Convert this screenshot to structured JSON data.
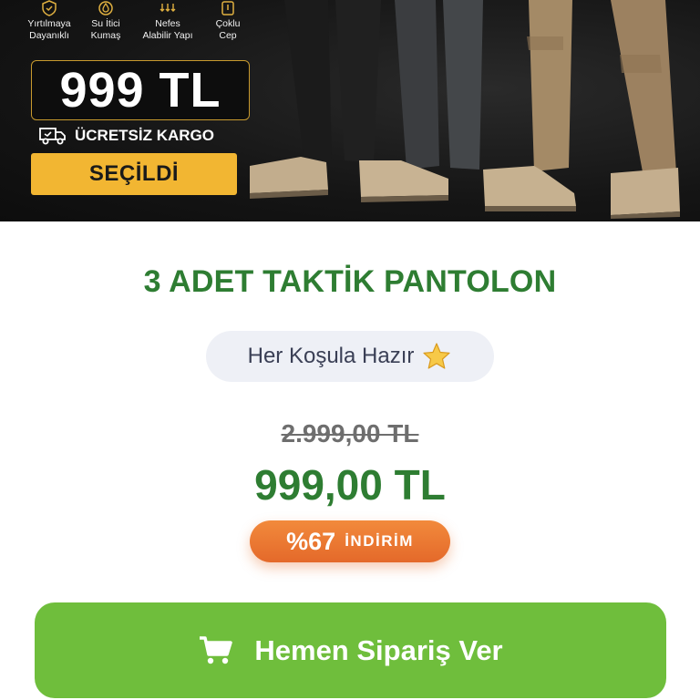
{
  "hero": {
    "features": [
      {
        "icon": "shield-icon",
        "label": "Yırtılmaya\nDayanıklı"
      },
      {
        "icon": "water-drop-icon",
        "label": "Su İtici\nKumaş"
      },
      {
        "icon": "arrows-down-icon",
        "label": "Nefes\nAlabilir Yapı"
      },
      {
        "icon": "pocket-icon",
        "label": "Çoklu\nCep"
      }
    ],
    "price": "999 TL",
    "cargo_label": "ÜCRETSİZ KARGO",
    "selected_label": "SEÇİLDİ"
  },
  "product": {
    "title": "3 ADET TAKTİK PANTOLON",
    "tagline": "Her Koşula Hazır",
    "old_price": "2.999,00 TL",
    "new_price": "999,00 TL",
    "discount_pct": "%67",
    "discount_label": "İNDİRİM"
  },
  "cta": {
    "order_label": "Hemen Sipariş Ver"
  },
  "colors": {
    "accent_green": "#2e7d32",
    "button_green": "#6fbe3c",
    "gold": "#f2b632",
    "orange": "#e4692a"
  }
}
